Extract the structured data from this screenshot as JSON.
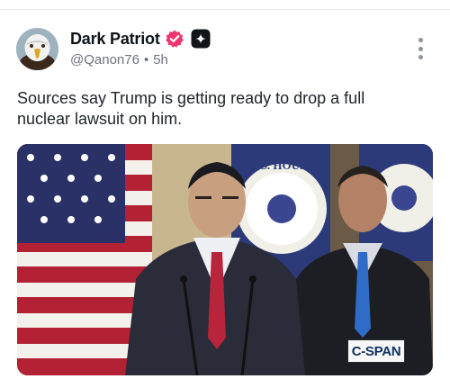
{
  "post": {
    "author": {
      "display_name": "Dark Patriot",
      "handle": "@Qanon76",
      "separator": "•",
      "time_ago": "5h",
      "avatar_icon": "eagle-avatar",
      "verified_badge_icon": "verified-badge-icon",
      "verified_badge_color": "#f0356e",
      "subscription_icon": "plus-badge-icon"
    },
    "text": "Sources say Trump is getting ready to drop a full nuclear lawsuit on him.",
    "more_icon": "more-vertical-icon",
    "media": {
      "watermark": "C-SPAN"
    }
  }
}
